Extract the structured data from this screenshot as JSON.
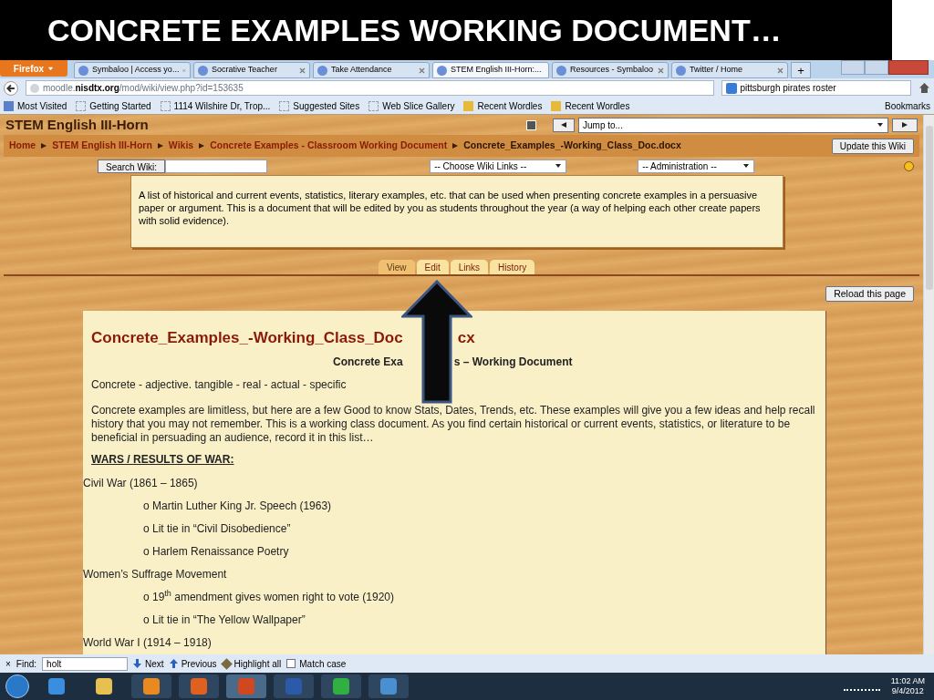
{
  "slide_title": "CONCRETE EXAMPLES WORKING DOCUMENT…",
  "browser": {
    "menu_button": "Firefox",
    "tabs": [
      {
        "label": "Symbaloo | Access yo...",
        "selected": false
      },
      {
        "label": "Socrative Teacher",
        "selected": false
      },
      {
        "label": "Take Attendance",
        "selected": false
      },
      {
        "label": "STEM English III-Horn:...",
        "selected": true
      },
      {
        "label": "Resources - Symbaloo",
        "selected": false
      },
      {
        "label": "Twitter / Home",
        "selected": false
      }
    ],
    "new_tab": "+",
    "url_host": "moodle.nisdtx.org",
    "url_path": "/mod/wiki/view.php?id=153635",
    "search_value": "pittsburgh pirates roster",
    "bookmarks": [
      "Most Visited",
      "Getting Started",
      "1114 Wilshire Dr, Trop...",
      "Suggested Sites",
      "Web Slice Gallery",
      "Recent Wordles",
      "Recent Wordles"
    ],
    "bookmarks_menu": "Bookmarks"
  },
  "page": {
    "course_title": "STEM English III-Horn",
    "jump_to": "Jump to...",
    "breadcrumb": [
      "Home",
      "STEM English III-Horn",
      "Wikis",
      "Concrete Examples - Classroom Working Document",
      "Concrete_Examples_-Working_Class_Doc.docx"
    ],
    "update_button": "Update this Wiki",
    "search_button": "Search Wiki:",
    "choose_links": "-- Choose Wiki Links --",
    "administration": "-- Administration --",
    "description": "A list of historical and current events, statistics, literary examples, etc. that can be used when presenting concrete examples in a persuasive paper or argument. This is a document that will be edited by you as students throughout the year (a way of helping each other create papers with solid evidence).",
    "wiki_tabs": [
      {
        "label": "View",
        "selected": true
      },
      {
        "label": "Edit",
        "selected": false
      },
      {
        "label": "Links",
        "selected": false
      },
      {
        "label": "History",
        "selected": false
      }
    ],
    "reload_button": "Reload this page",
    "doc": {
      "heading_left": "Concrete_Examples_-Working_Class_Doc",
      "heading_right": "cx",
      "subtitle_left": "Concrete Exa",
      "subtitle_right": "s – Working Document",
      "definition": "Concrete - adjective. tangible - real - actual - specific",
      "intro": "Concrete examples are limitless, but here are a few Good to know Stats, Dates, Trends, etc. These examples will give you a few ideas and help recall history that you may not remember. This is a working class document. As you find certain historical or current events, statistics, or literature to be beneficial in persuading an audience, record it in this list…",
      "section": "WARS / RESULTS OF WAR:",
      "items": [
        {
          "text": "Civil War (1861 – 1865)",
          "children": [
            {
              "text": "o Martin Luther King Jr. Speech (1963)"
            },
            {
              "text": "o Lit tie in “Civil Disobedience”"
            },
            {
              "text": "o Harlem Renaissance Poetry"
            }
          ]
        },
        {
          "text": "Women’s Suffrage Movement",
          "children": [
            {
              "text": "o 19$^{th}$ amendment gives women right to vote (1920)"
            },
            {
              "text": "o Lit tie in “The Yellow Wallpaper”"
            }
          ]
        },
        {
          "text": "World War I (1914 – 1918)"
        }
      ]
    }
  },
  "find_bar": {
    "close": "×",
    "label": "Find:",
    "value": "holt",
    "next": "Next",
    "previous": "Previous",
    "highlight": "Highlight all",
    "match_case": {
      "label": "Match case",
      "checked": false
    }
  },
  "taskbar": {
    "time": "11:02 AM",
    "date": "9/4/2012"
  }
}
